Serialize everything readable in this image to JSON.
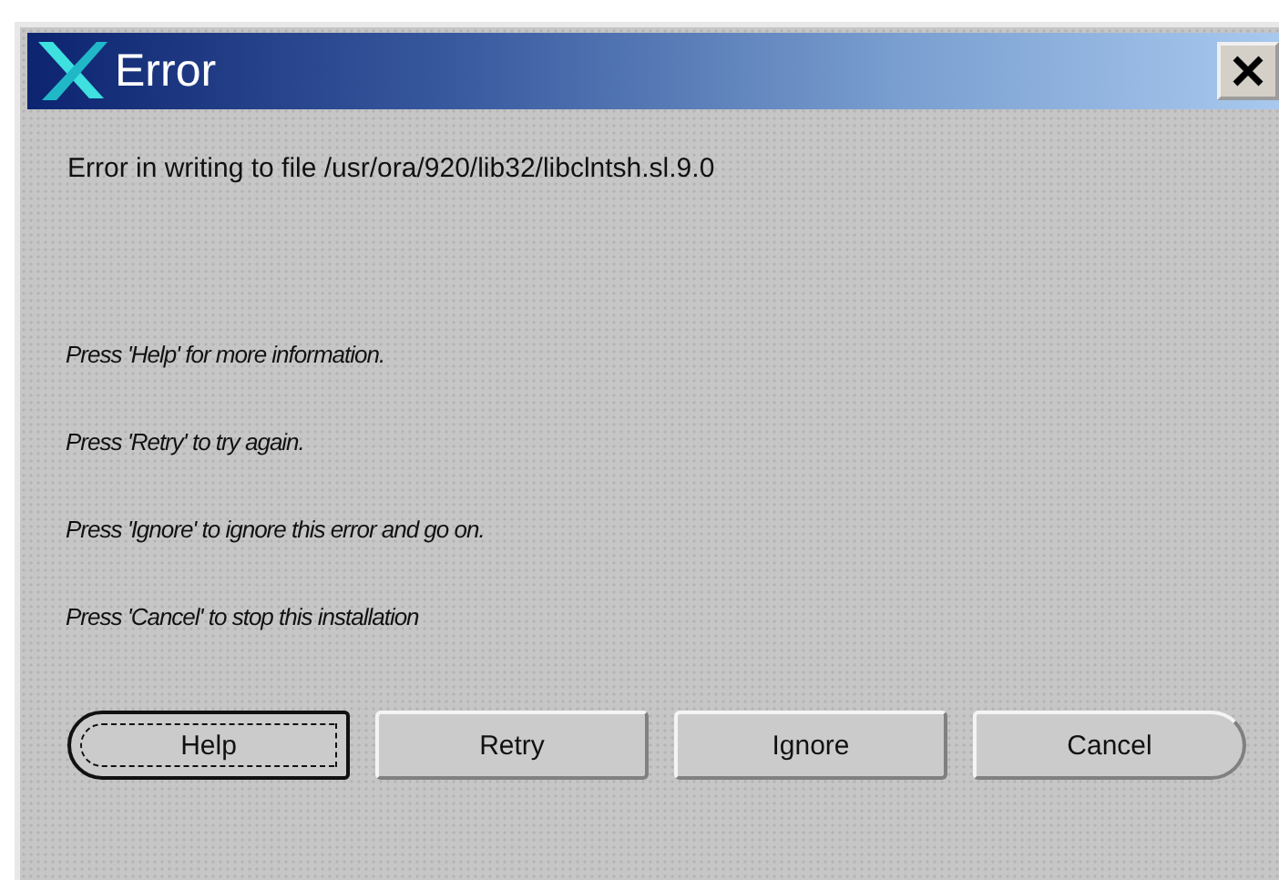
{
  "window": {
    "title": "Error"
  },
  "message": "Error in writing to file /usr/ora/920/lib32/libclntsh.sl.9.0",
  "instructions": [
    "Press 'Help' for more information.",
    "Press 'Retry' to try again.",
    "Press 'Ignore' to ignore this error and go on.",
    "Press 'Cancel' to stop this installation"
  ],
  "buttons": [
    {
      "label": "Help",
      "focused": true
    },
    {
      "label": "Retry",
      "focused": false
    },
    {
      "label": "Ignore",
      "focused": false
    },
    {
      "label": "Cancel",
      "focused": false
    }
  ]
}
